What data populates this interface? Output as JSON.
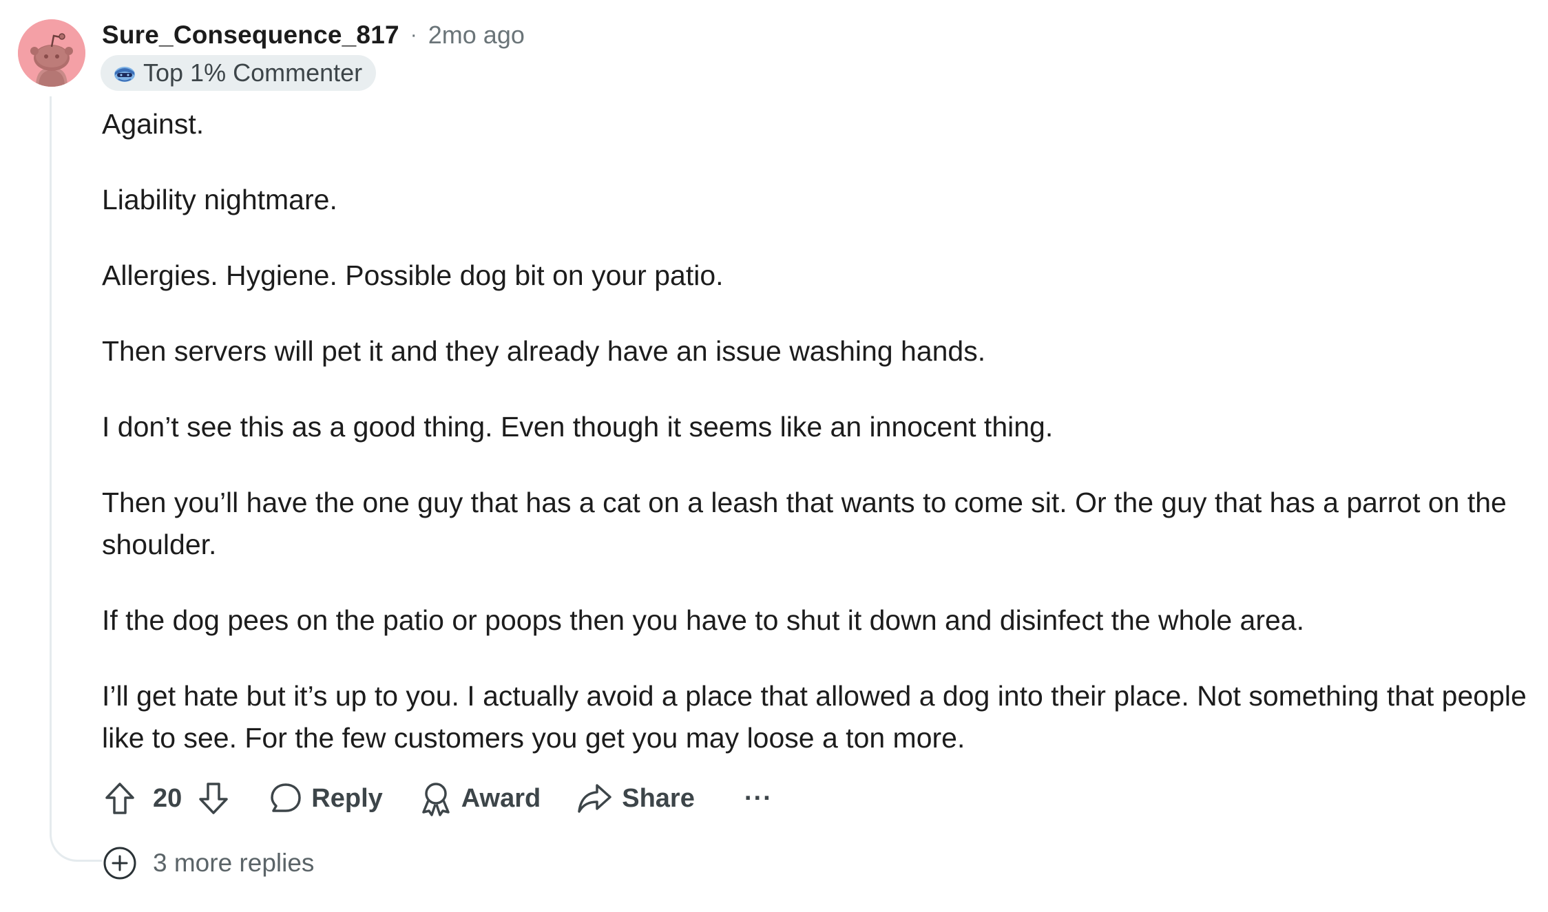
{
  "comment": {
    "author": "Sure_Consequence_817",
    "separator": "·",
    "timestamp": "2mo ago",
    "badge": {
      "label": "Top 1% Commenter",
      "icon": "commenter-badge-icon"
    },
    "avatar_icon": "reddit-snoo-avatar",
    "avatar_color": "#f4a0a6",
    "paragraphs": [
      "Against.",
      "Liability nightmare.",
      "Allergies. Hygiene. Possible dog bit on your patio.",
      "Then servers will pet it and they already have an issue washing hands.",
      "I don’t see this as a good thing. Even though it seems like an innocent thing.",
      "Then you’ll have the one guy that has a cat on a leash that wants to come sit. Or the guy that has a parrot on the shoulder.",
      "If the dog pees on the patio or poops then you have to shut it down and disinfect the whole area.",
      "I’ll get hate but it’s up to you. I actually avoid a place that allowed a dog into their place. Not something that people like to see. For the few customers you get you may loose a ton more."
    ],
    "actions": {
      "score": "20",
      "upvote_icon": "upvote-arrow-icon",
      "downvote_icon": "downvote-arrow-icon",
      "reply_label": "Reply",
      "reply_icon": "speech-bubble-icon",
      "award_label": "Award",
      "award_icon": "award-ribbon-icon",
      "share_label": "Share",
      "share_icon": "share-arrow-icon",
      "more_label": "···"
    },
    "more_replies": {
      "label": "3 more replies",
      "icon": "plus-circle-icon"
    }
  }
}
